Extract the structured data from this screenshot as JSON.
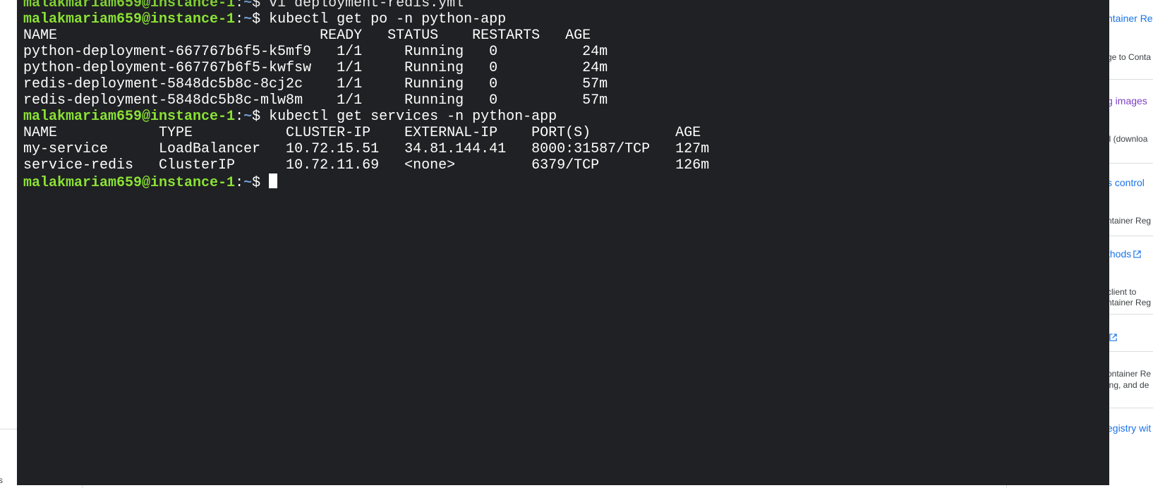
{
  "terminal": {
    "user_host": "malakmariam659@instance-1",
    "path": "~",
    "prompt_symbol": "$",
    "partial_top_command": " vi deployment-redis.yml",
    "command_1": " kubectl get po -n python-app",
    "pods": {
      "header": "NAME                               READY   STATUS    RESTARTS   AGE",
      "rows": [
        "python-deployment-667767b6f5-k5mf9   1/1     Running   0          24m",
        "python-deployment-667767b6f5-kwfsw   1/1     Running   0          24m",
        "redis-deployment-5848dc5b8c-8cj2c    1/1     Running   0          57m",
        "redis-deployment-5848dc5b8c-mlw8m    1/1     Running   0          57m"
      ]
    },
    "command_2": " kubectl get services -n python-app",
    "services": {
      "header": "NAME            TYPE           CLUSTER-IP    EXTERNAL-IP    PORT(S)          AGE",
      "rows": [
        "my-service      LoadBalancer   10.72.15.51   34.81.144.41   8000:31587/TCP   127m",
        "service-redis   ClusterIP      10.72.11.69   <none>         6379/TCP         126m"
      ]
    },
    "final_prompt_suffix": " "
  },
  "background_panel": {
    "item_1": "ntainer Reg",
    "item_2": "ge to Conta",
    "item_3": "g images",
    "item_4": "ll (downloa",
    "item_5": "s control",
    "item_6": "ntainer Reg",
    "item_7": "thods",
    "item_8a": "client to",
    "item_8b": "ntainer Reg",
    "item_9a": "ontainer Re",
    "item_9b": "ing, and de",
    "item_10": "egistry wit"
  },
  "left_strip": {
    "text": "s"
  },
  "colors": {
    "terminal_bg": "#202124",
    "prompt_user": "#8ae234",
    "prompt_path": "#729fcf",
    "link": "#1a73e8",
    "visited_link": "#7b3fc6"
  }
}
